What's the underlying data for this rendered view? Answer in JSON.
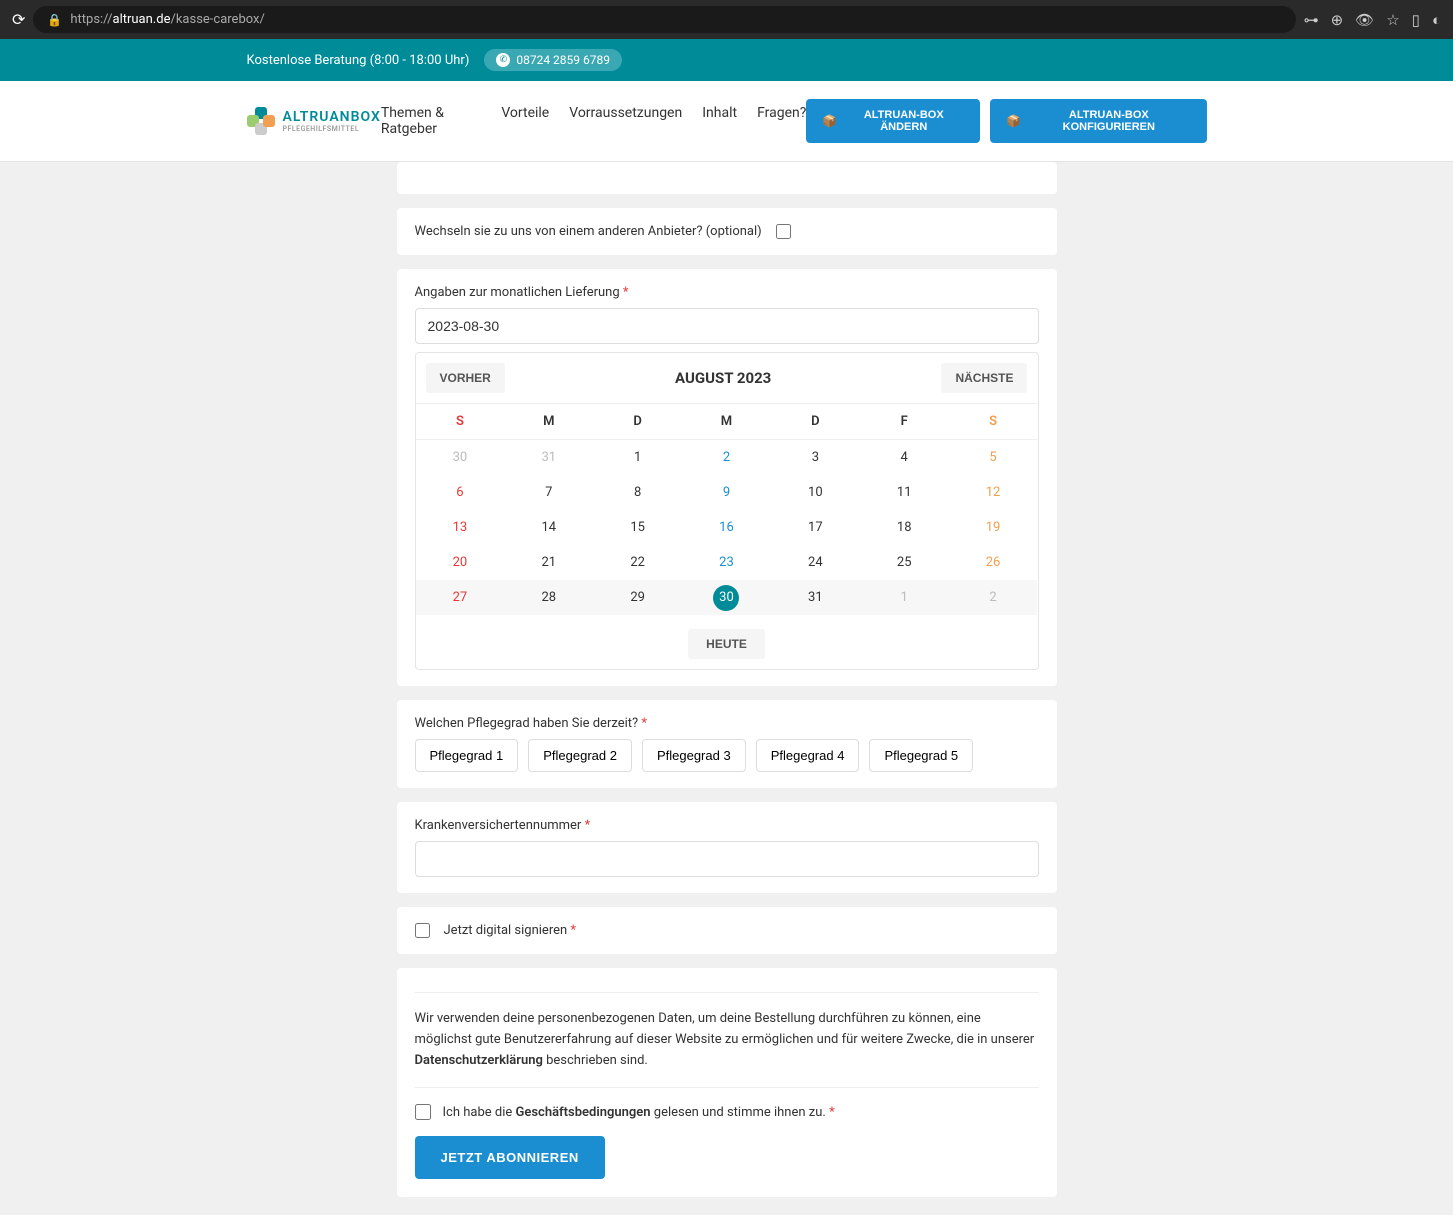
{
  "browser": {
    "url_prefix": "https://",
    "url_domain": "altruan.de",
    "url_path": "/kasse-carebox/"
  },
  "topbar": {
    "consult_text": "Kostenlose Beratung (8:00 - 18:00 Uhr)",
    "phone": "08724 2859 6789"
  },
  "header": {
    "logo_text": "ALTRUANBOX",
    "logo_sub": "PFLEGEHILFSMITTEL",
    "nav": [
      "Themen & Ratgeber",
      "Vorteile",
      "Vorraussetzungen",
      "Inhalt",
      "Fragen?"
    ],
    "btn_change": "ALTRUAN-BOX ÄNDERN",
    "btn_config": "ALTRUAN-BOX KONFIGURIEREN"
  },
  "form": {
    "switch_label": "Wechseln sie zu uns von einem anderen Anbieter? (optional)",
    "delivery_label": "Angaben zur monatlichen Lieferung",
    "date_value": "2023-08-30",
    "calendar": {
      "prev": "VORHER",
      "next": "NÄCHSTE",
      "title": "AUGUST 2023",
      "today": "HEUTE",
      "dayheads": [
        "S",
        "M",
        "D",
        "M",
        "D",
        "F",
        "S"
      ],
      "weeks": [
        [
          {
            "d": "30",
            "cls": "other-month"
          },
          {
            "d": "31",
            "cls": "other-month"
          },
          {
            "d": "1"
          },
          {
            "d": "2",
            "cls": "wed"
          },
          {
            "d": "3"
          },
          {
            "d": "4"
          },
          {
            "d": "5",
            "cls": "sat"
          }
        ],
        [
          {
            "d": "6",
            "cls": "sun"
          },
          {
            "d": "7"
          },
          {
            "d": "8"
          },
          {
            "d": "9",
            "cls": "wed"
          },
          {
            "d": "10"
          },
          {
            "d": "11"
          },
          {
            "d": "12",
            "cls": "sat"
          }
        ],
        [
          {
            "d": "13",
            "cls": "sun"
          },
          {
            "d": "14"
          },
          {
            "d": "15"
          },
          {
            "d": "16",
            "cls": "wed"
          },
          {
            "d": "17"
          },
          {
            "d": "18"
          },
          {
            "d": "19",
            "cls": "sat"
          }
        ],
        [
          {
            "d": "20",
            "cls": "sun"
          },
          {
            "d": "21"
          },
          {
            "d": "22"
          },
          {
            "d": "23",
            "cls": "wed"
          },
          {
            "d": "24"
          },
          {
            "d": "25"
          },
          {
            "d": "26",
            "cls": "sat"
          }
        ],
        [
          {
            "d": "27",
            "cls": "sun"
          },
          {
            "d": "28"
          },
          {
            "d": "29"
          },
          {
            "d": "30",
            "cls": "wed selected"
          },
          {
            "d": "31"
          },
          {
            "d": "1",
            "cls": "other-month"
          },
          {
            "d": "2",
            "cls": "other-month"
          }
        ]
      ]
    },
    "pflege_label": "Welchen Pflegegrad haben Sie derzeit?",
    "pflege_options": [
      "Pflegegrad 1",
      "Pflegegrad 2",
      "Pflegegrad 3",
      "Pflegegrad 4",
      "Pflegegrad 5"
    ],
    "insurance_label": "Krankenversichertennummer",
    "sign_label": "Jetzt digital signieren",
    "privacy_text_1": "Wir verwenden deine personenbezogenen Daten, um deine Bestellung durchführen zu können, eine möglichst gute Benutzererfahrung auf dieser Website zu ermöglichen und für weitere Zwecke, die in unserer ",
    "privacy_link": "Datenschutzerklärung",
    "privacy_text_2": " beschrieben sind.",
    "terms_prefix": "Ich habe die ",
    "terms_link": "Geschäftsbedingungen",
    "terms_suffix": " gelesen und stimme ihnen zu.",
    "submit": "JETZT ABONNIEREN"
  }
}
